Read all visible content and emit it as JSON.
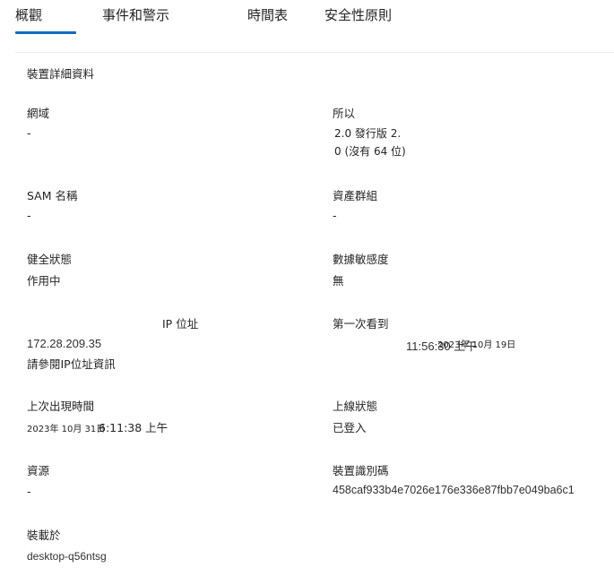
{
  "tabs": [
    {
      "label": "概觀",
      "active": true
    },
    {
      "label": "事件和警示",
      "active": false
    },
    {
      "label": "時間表",
      "active": false
    },
    {
      "label": "安全性原則",
      "active": false
    }
  ],
  "colors": {
    "accent": "#0f6cbd",
    "text": "#242424"
  },
  "section": {
    "title": "裝置詳細資料"
  },
  "details": {
    "domain": {
      "label": "網域",
      "value": "-"
    },
    "os": {
      "label": "所以",
      "value_line1": "2.0 發行版 2.",
      "value_line2": "0 (沒有 64 位)"
    },
    "sam": {
      "label": "SAM 名稱",
      "value": "-"
    },
    "asset_group": {
      "label": "資產群組",
      "value": "-"
    },
    "health": {
      "label": "健全狀態",
      "value": "作用中"
    },
    "sensitivity": {
      "label": "數據敏感度",
      "value": "無"
    },
    "ip": {
      "label": "IP 位址",
      "value": "172.28.209.35",
      "link": "請參閱IP位址資訊"
    },
    "first_seen": {
      "label": "第一次看到",
      "time": "11:56:30 上午",
      "date": "2023年 10月 19日"
    },
    "last_seen": {
      "label": "上次出現時間",
      "date": "2023年 10月 31日",
      "time": "6:11:38 上午"
    },
    "onboarding": {
      "label": "上線狀態",
      "value": "已登入"
    },
    "source": {
      "label": "資源",
      "value": "-"
    },
    "device_id": {
      "label": "裝置識別碼",
      "value": "458caf933b4e7026e176e336e87fbb7e049ba6c1"
    },
    "loaded_on": {
      "label": "裝載於",
      "value": "desktop-q56ntsg"
    }
  }
}
